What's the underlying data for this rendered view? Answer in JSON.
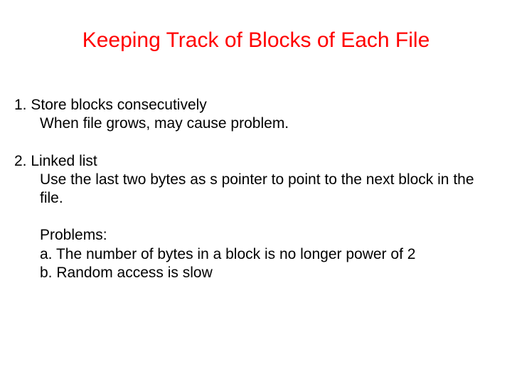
{
  "title": "Keeping Track of Blocks of Each File",
  "item1": {
    "heading": "1. Store blocks consecutively",
    "detail": "When file grows, may cause problem."
  },
  "item2": {
    "heading": "2. Linked list",
    "detail": "Use the last two bytes as s pointer to point to the next block in the file.",
    "problems_label": "Problems:",
    "problem_a": "a. The number of bytes in a block is no longer power of 2",
    "problem_b": "b. Random access is slow"
  }
}
